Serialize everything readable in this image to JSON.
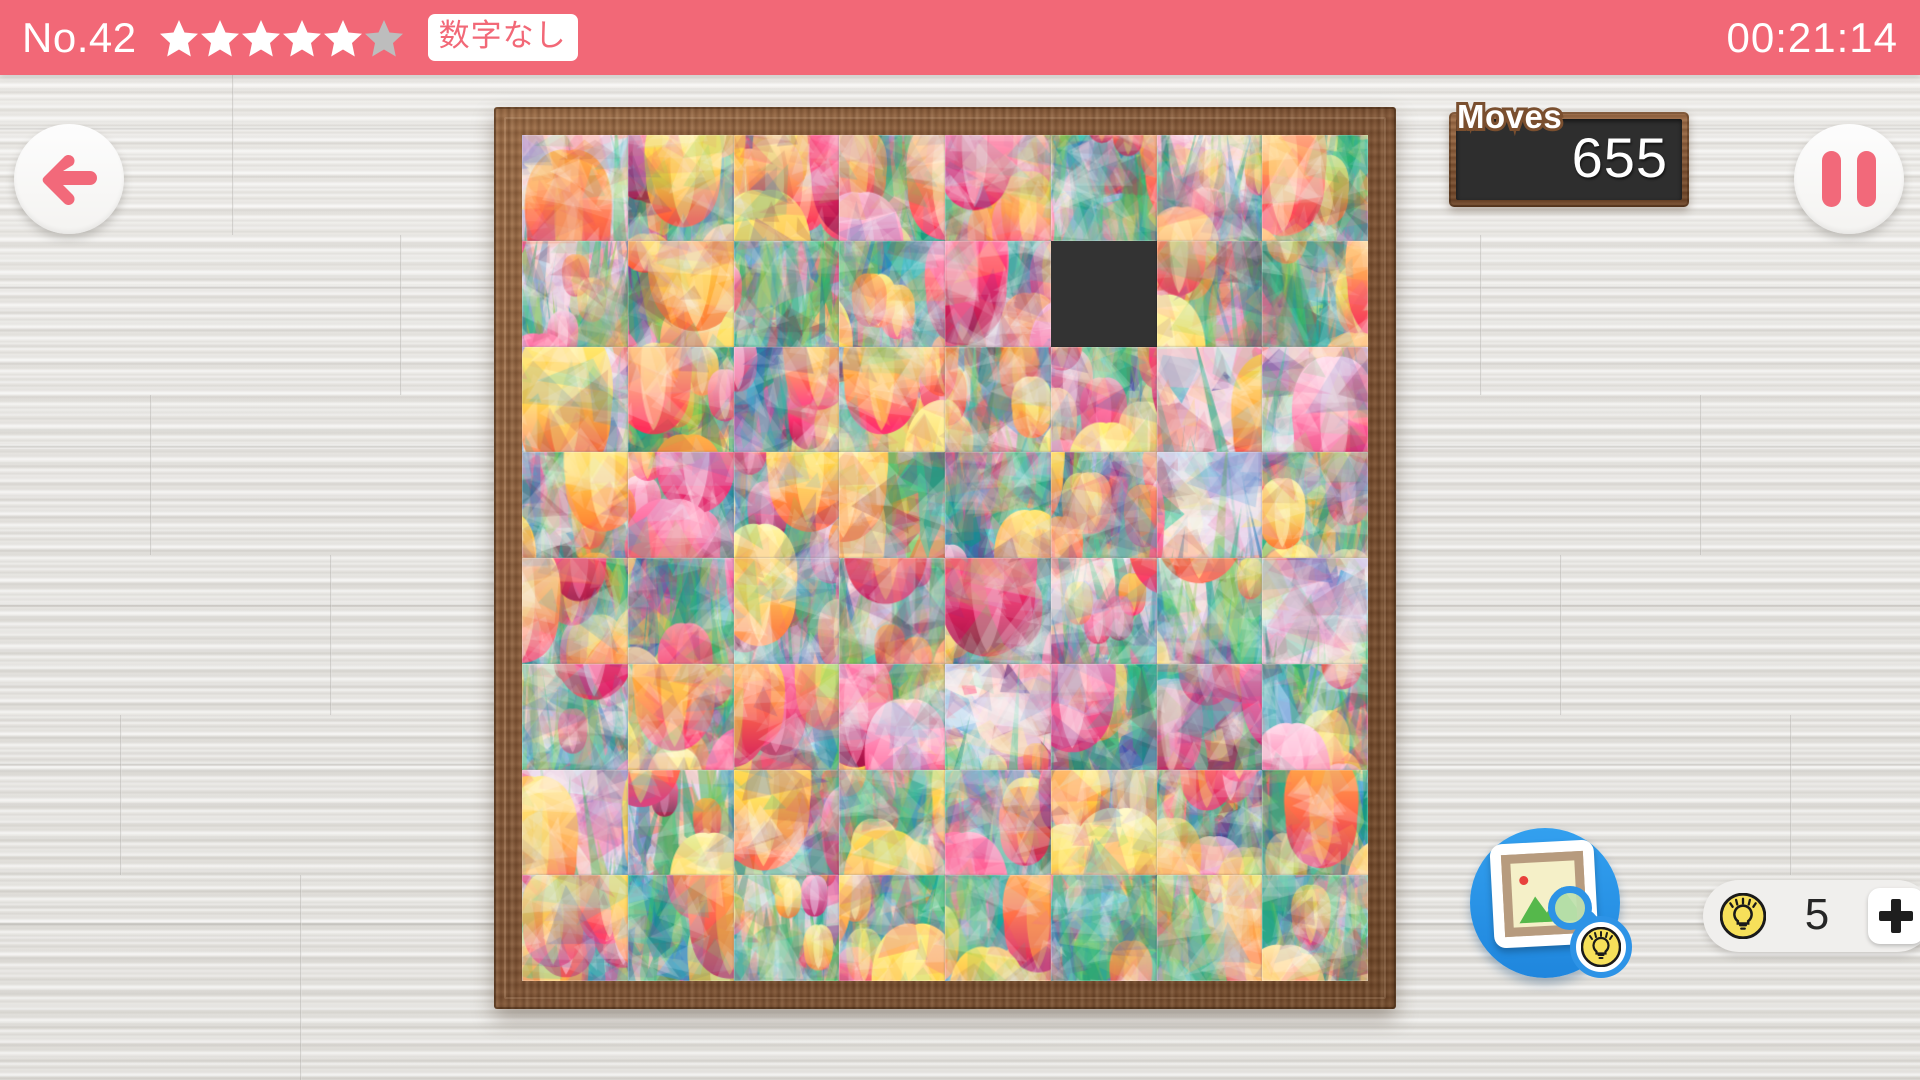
{
  "header": {
    "level_label": "No.42",
    "stars_total": 6,
    "stars_filled": 5,
    "star_filled_color": "#ffffff",
    "star_empty_color": "#bdbdbd",
    "mode_badge": "数字なし",
    "timer": "00:21:14",
    "bar_color": "#f26877"
  },
  "controls": {
    "back_icon": "arrow-left-icon",
    "pause_icon": "pause-icon",
    "accent_color": "#f2697a"
  },
  "moves": {
    "label": "Moves",
    "value": "655"
  },
  "puzzle": {
    "rows": 8,
    "cols": 8,
    "empty_row": 2,
    "empty_col": 6,
    "empty_tile_color": "#333333",
    "frame_color": "#7d5132",
    "image_subject": "tulip-field-mosaic"
  },
  "peek": {
    "icon": "image-preview-icon",
    "badge_icon": "lightbulb-coin-icon",
    "disc_color": "#2d93e6"
  },
  "hints": {
    "coin_icon": "lightbulb-coin-icon",
    "count": "5",
    "add_label": "+",
    "coin_color": "#f7e05a"
  },
  "background": {
    "wall_color": "#e6e4e0"
  }
}
